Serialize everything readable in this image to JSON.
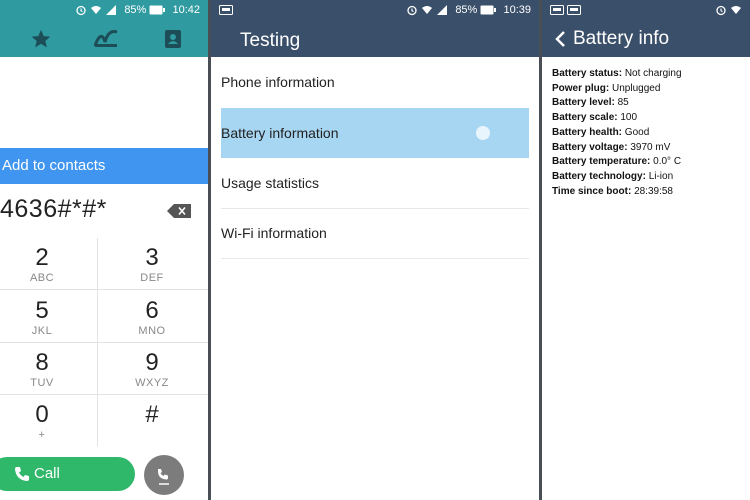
{
  "dialer": {
    "status": {
      "battery": "85%",
      "time": "10:42"
    },
    "add_contacts": "Add to contacts",
    "number": "4636#*#*",
    "keys": [
      {
        "digit": "2",
        "letters": "ABC"
      },
      {
        "digit": "3",
        "letters": "DEF"
      },
      {
        "digit": "5",
        "letters": "JKL"
      },
      {
        "digit": "6",
        "letters": "MNO"
      },
      {
        "digit": "8",
        "letters": "TUV"
      },
      {
        "digit": "9",
        "letters": "WXYZ"
      },
      {
        "digit": "0",
        "letters": "+"
      },
      {
        "digit": "#",
        "letters": ""
      }
    ],
    "call_label": "Call",
    "colors": {
      "header": "#2f9aa0",
      "add_contacts": "#3f95f0",
      "call": "#2fb86a"
    }
  },
  "testing": {
    "status": {
      "battery": "85%",
      "time": "10:39"
    },
    "title": "Testing",
    "items": [
      {
        "label": "Phone information"
      },
      {
        "label": "Battery information"
      },
      {
        "label": "Usage statistics"
      },
      {
        "label": "Wi-Fi information"
      }
    ],
    "selected_index": 1,
    "colors": {
      "header": "#3a4f6a",
      "selected": "#a7d6f2"
    }
  },
  "battery": {
    "title": "Battery info",
    "rows": [
      {
        "key": "Battery status:",
        "value": "Not charging"
      },
      {
        "key": "Power plug:",
        "value": "Unplugged"
      },
      {
        "key": "Battery level:",
        "value": "85"
      },
      {
        "key": "Battery scale:",
        "value": "100"
      },
      {
        "key": "Battery health:",
        "value": "Good"
      },
      {
        "key": "Battery voltage:",
        "value": "3970 mV"
      },
      {
        "key": "Battery temperature:",
        "value": "0.0° C"
      },
      {
        "key": "Battery technology:",
        "value": "Li-ion"
      },
      {
        "key": "Time since boot:",
        "value": "28:39:58"
      }
    ]
  }
}
